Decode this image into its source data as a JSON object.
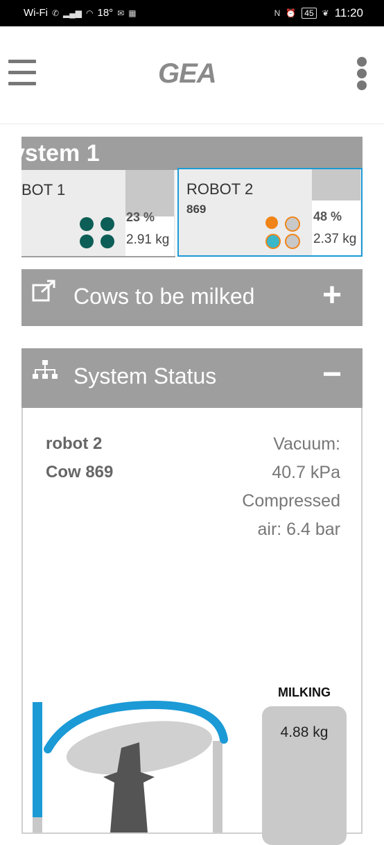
{
  "status_bar": {
    "network": "Wi-Fi",
    "temperature": "18°",
    "nfc": "N",
    "battery": "45",
    "time": "11:20"
  },
  "header": {
    "logo": "GEA"
  },
  "system": {
    "title": "ystem 1",
    "robots": [
      {
        "name": "BOT 1",
        "cow": "",
        "percent": "23 %",
        "fill_fraction": 0.23,
        "milk": "2.91 kg",
        "teat_colors": [
          "#0c5e56",
          "#0c5e56",
          "#0c5e56",
          "#0c5e56"
        ]
      },
      {
        "name": "ROBOT 2",
        "cow": "869",
        "percent": "48 %",
        "fill_fraction": 0.48,
        "milk": "2.37 kg",
        "teat_colors": [
          "#f08418",
          "#c8c8c8",
          "#3ab7c8",
          "#c8c8c8"
        ]
      }
    ]
  },
  "cows_section": {
    "label": "Cows to be milked",
    "toggle": "+"
  },
  "status_section": {
    "label": "System Status",
    "toggle": "−",
    "robot": "robot 2",
    "cow": "Cow 869",
    "vacuum_line1": "Vacuum:",
    "vacuum_line2": "40.7 kPa",
    "air_line1": "Compressed",
    "air_line2": "air: 6.4 bar",
    "milking_state": "MILKING",
    "milking_amount": "4.88 kg"
  },
  "colors": {
    "accent": "#1b9ad6",
    "bar_gray": "#9e9e9e"
  }
}
